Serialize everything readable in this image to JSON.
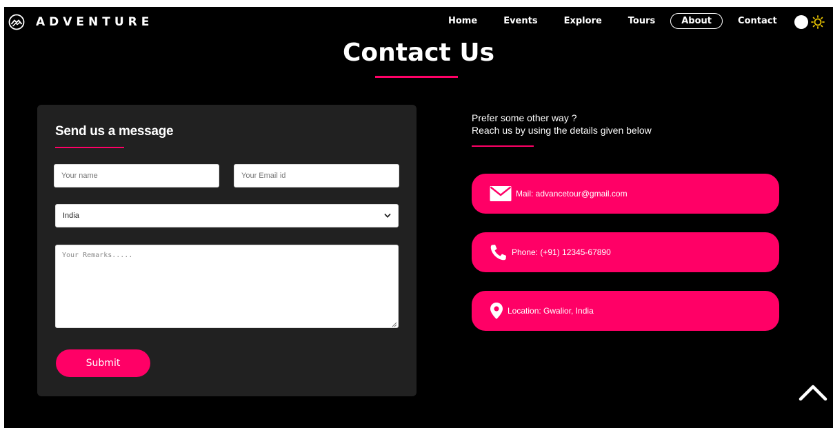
{
  "brand": {
    "name": "ADVENTURE"
  },
  "nav": {
    "home": "Home",
    "events": "Events",
    "explore": "Explore",
    "tours": "Tours",
    "about": "About",
    "contact": "Contact"
  },
  "page": {
    "title": "Contact Us"
  },
  "form": {
    "heading": "Send us a message",
    "name_placeholder": "Your name",
    "email_placeholder": "Your Email id",
    "country_selected": "India",
    "remarks_placeholder": "Your Remarks.....",
    "submit_label": "Submit"
  },
  "contact": {
    "intro_line1": "Prefer some other way ?",
    "intro_line2": "Reach us by using the details given below",
    "mail": "Mail: advancetour@gmail.com",
    "phone": "Phone: (+91) 12345-67890",
    "location": "Location: Gwalior, India"
  },
  "colors": {
    "accent": "#ff0066",
    "background": "#000000",
    "card": "#212121",
    "sun": "#e6c200"
  },
  "icons": [
    "logo-mountain-icon",
    "sun-icon",
    "chevron-down-icon",
    "mail-icon",
    "phone-icon",
    "location-pin-icon",
    "chevron-up-icon"
  ]
}
